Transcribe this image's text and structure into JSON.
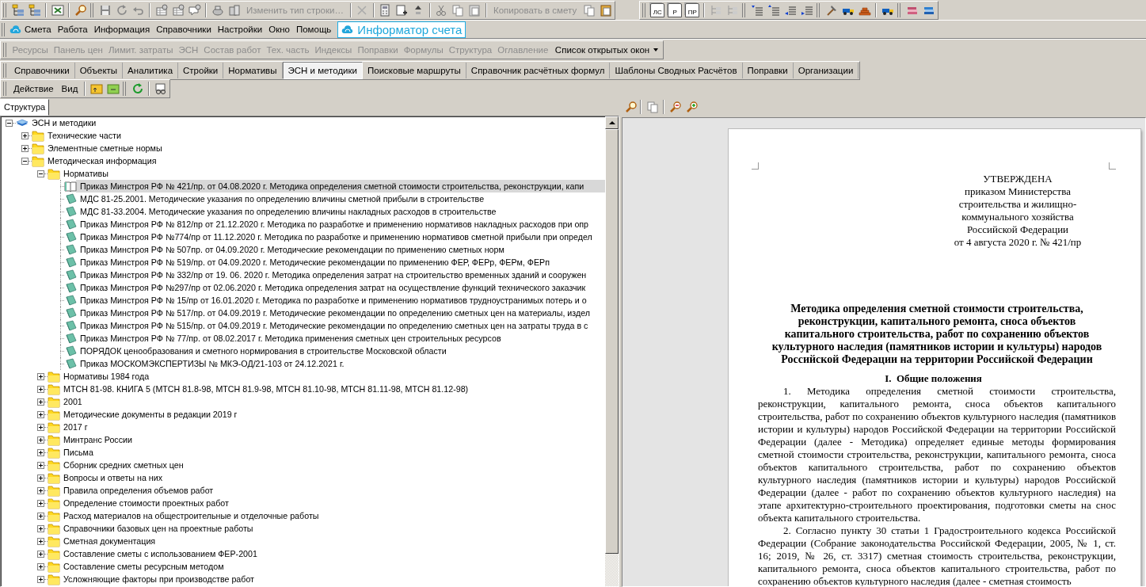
{
  "toolbar": {
    "buttons": [
      {
        "label": "Изменить тип строки…",
        "disabled": true
      },
      {
        "label": "Копировать в смету",
        "disabled": true
      }
    ],
    "badges": [
      "ЛС",
      "Р",
      "ПР"
    ]
  },
  "menu": {
    "items": [
      {
        "label": "Смета",
        "kind": "app"
      },
      {
        "label": "Работа",
        "kind": "plain"
      },
      {
        "label": "Информация",
        "kind": "plain"
      },
      {
        "label": "Справочники",
        "kind": "plain"
      },
      {
        "label": "Настройки",
        "kind": "plain"
      },
      {
        "label": "Окно",
        "kind": "plain"
      },
      {
        "label": "Помощь",
        "kind": "plain"
      }
    ],
    "informer": "Информатор счета"
  },
  "panel_bar": {
    "items": [
      {
        "label": "Ресурсы",
        "disabled": true
      },
      {
        "label": "Панель цен",
        "disabled": true
      },
      {
        "label": "Лимит. затраты",
        "disabled": true
      },
      {
        "label": "ЭСН",
        "disabled": true
      },
      {
        "label": "Состав работ",
        "disabled": true
      },
      {
        "label": "Тех. часть",
        "disabled": true
      },
      {
        "label": "Индексы",
        "disabled": true
      },
      {
        "label": "Поправки",
        "disabled": true
      },
      {
        "label": "Формулы",
        "disabled": true
      },
      {
        "label": "Структура",
        "disabled": true
      },
      {
        "label": "Оглавление",
        "disabled": true
      }
    ],
    "dropdown": "Список открытых окон"
  },
  "tabs": [
    {
      "label": "Справочники",
      "selected": false
    },
    {
      "label": "Объекты",
      "selected": false
    },
    {
      "label": "Аналитика",
      "selected": false
    },
    {
      "label": "Стройки",
      "selected": false
    },
    {
      "label": "Нормативы",
      "selected": false
    },
    {
      "label": "ЭСН и методики",
      "selected": true
    },
    {
      "label": "Поисковые маршруты",
      "selected": false
    },
    {
      "label": "Справочник расчётных формул",
      "selected": false
    },
    {
      "label": "Шаблоны Сводных Расчётов",
      "selected": false
    },
    {
      "label": "Поправки",
      "selected": false
    },
    {
      "label": "Организации",
      "selected": false
    }
  ],
  "actions": [
    "Действие",
    "Вид"
  ],
  "structure_tab": "Структура",
  "tree": {
    "label": "ЭСН и методики",
    "kind": "root",
    "expanded": true,
    "selected": false,
    "children": [
      {
        "label": "Технические части",
        "kind": "folder",
        "expanded": false,
        "selected": false
      },
      {
        "label": "Элементные сметные нормы",
        "kind": "folder",
        "expanded": false,
        "selected": false
      },
      {
        "label": "Методическая информация",
        "kind": "folder",
        "expanded": true,
        "selected": false,
        "children": [
          {
            "label": "Нормативы",
            "kind": "folder",
            "expanded": true,
            "selected": false,
            "children": [
              {
                "label": "Приказ Минстроя РФ № 421/пр. от 04.08.2020 г. Методика определения сметной стоимости строительства, реконструкции, капи",
                "kind": "open-book",
                "selected": true
              },
              {
                "label": "МДС 81-25.2001. Методические указания по определению вличины сметной прибыли в строительстве",
                "kind": "book",
                "selected": false
              },
              {
                "label": "МДС 81-33.2004. Методические указания по определению вличины накладных расходов в строительстве",
                "kind": "book",
                "selected": false
              },
              {
                "label": "Приказ Минстроя РФ № 812/пр от 21.12.2020 г. Методика по разработке и применению нормативов накладных расходов при опр",
                "kind": "book",
                "selected": false
              },
              {
                "label": "Приказ Минстроя РФ №774/пр от 11.12.2020 г. Методика по разработке и применению нормативов сметной прибыли при определ",
                "kind": "book",
                "selected": false
              },
              {
                "label": "Приказ Минстроя РФ № 507пр. от 04.09.2020 г. Методические рекомендации по применению сметных норм",
                "kind": "book",
                "selected": false
              },
              {
                "label": "Приказ Минстроя РФ № 519/пр. от 04.09.2020 г. Методические рекомендации по применению ФЕР, ФЕРр, ФЕРм, ФЕРп",
                "kind": "book",
                "selected": false
              },
              {
                "label": "Приказ Минстроя РФ № 332/пр от 19. 06. 2020 г. Методика определения затрат на строительство временных зданий и сооружен",
                "kind": "book",
                "selected": false
              },
              {
                "label": "Приказ Минстроя РФ №297/пр от 02.06.2020 г. Методика определения затрат на осуществление функций технического заказчик",
                "kind": "book",
                "selected": false
              },
              {
                "label": "Приказ Минстроя РФ № 15/пр от 16.01.2020 г. Методика по разработке и применению нормативов трудноустранимых потерь и о",
                "kind": "book",
                "selected": false
              },
              {
                "label": "Приказ Минстроя РФ № 517/пр. от 04.09.2019 г. Методические рекомендации по определению сметных цен на материалы, издел",
                "kind": "book",
                "selected": false
              },
              {
                "label": "Приказ Минстроя РФ № 515/пр. от 04.09.2019 г. Методические рекомендации по определению сметных цен на затраты труда в с",
                "kind": "book",
                "selected": false
              },
              {
                "label": "Приказ Минстроя РФ № 77/пр. от 08.02.2017 г. Методика применения сметных цен строительных ресурсов",
                "kind": "book",
                "selected": false
              },
              {
                "label": "ПОРЯДОК ценообразования и сметного нормирования в строительстве Московской области",
                "kind": "book",
                "selected": false
              },
              {
                "label": "Приказ МОСКОМЭКСПЕРТИЗЫ № МКЭ-ОД/21-103 от 24.12.2021 г.",
                "kind": "book",
                "selected": false
              }
            ]
          },
          {
            "label": "Нормативы 1984 года",
            "kind": "folder",
            "expanded": false,
            "selected": false
          },
          {
            "label": "МТСН 81-98. КНИГА 5 (МТСН 81.8-98, МТСН 81.9-98, МТСН 81.10-98, МТСН 81.11-98, МТСН 81.12-98)",
            "kind": "folder",
            "expanded": false,
            "selected": false
          },
          {
            "label": "2001",
            "kind": "folder",
            "expanded": false,
            "selected": false
          },
          {
            "label": "Методические документы в редакции 2019 г",
            "kind": "folder",
            "expanded": false,
            "selected": false
          },
          {
            "label": "2017 г",
            "kind": "folder",
            "expanded": false,
            "selected": false
          },
          {
            "label": "Минтранс России",
            "kind": "folder",
            "expanded": false,
            "selected": false
          },
          {
            "label": "Письма",
            "kind": "folder",
            "expanded": false,
            "selected": false
          },
          {
            "label": "Сборник средних сметных цен",
            "kind": "folder",
            "expanded": false,
            "selected": false
          },
          {
            "label": "Вопросы и ответы на них",
            "kind": "folder",
            "expanded": false,
            "selected": false
          },
          {
            "label": "Правила определения объемов работ",
            "kind": "folder",
            "expanded": false,
            "selected": false
          },
          {
            "label": "Определение стоимости проектных работ",
            "kind": "folder",
            "expanded": false,
            "selected": false
          },
          {
            "label": "Расход материалов на общестроительные и отделочные работы",
            "kind": "folder",
            "expanded": false,
            "selected": false
          },
          {
            "label": "Справочники базовых цен на проектные работы",
            "kind": "folder",
            "expanded": false,
            "selected": false
          },
          {
            "label": "Сметная документация",
            "kind": "folder",
            "expanded": false,
            "selected": false
          },
          {
            "label": "Составление сметы с использованием  ФЕР-2001",
            "kind": "folder",
            "expanded": false,
            "selected": false
          },
          {
            "label": "Составление сметы ресурсным методом",
            "kind": "folder",
            "expanded": false,
            "selected": false
          },
          {
            "label": "Усложняющие факторы при производстве работ",
            "kind": "folder",
            "expanded": false,
            "selected": false
          }
        ]
      }
    ]
  },
  "document": {
    "approval": [
      "УТВЕРЖДЕНА",
      "приказом Министерства",
      "строительства и жилищно-",
      "коммунального хозяйства",
      "Российской Федерации",
      "от 4 августа 2020 г. № 421/пр"
    ],
    "title": "Методика определения сметной стоимости строительства, реконструкции, капитального ремонта, сноса объектов капитального строительства, работ по сохранению объектов культурного наследия (памятников истории и культуры) народов Российской Федерации на территории Российской Федерации",
    "heading": "I.  Общие положения",
    "paragraphs": [
      "1. Методика определения сметной стоимости строительства, реконструкции, капитального ремонта, сноса объектов капитального строительства, работ по сохранению объектов культурного наследия (памятников истории и культуры) народов Российской Федерации на территории Российской Федерации (далее - Методика) определяет единые методы формирования сметной стоимости строительства, реконструкции, капитального ремонта, сноса объектов капитального строительства, работ по сохранению объектов культурного наследия (памятников истории и культуры) народов Российской Федерации (далее - работ по сохранению объектов культурного наследия) на этапе архитектурно-строительного проектирования, подготовки сметы на снос объекта капитального строительства.",
      "2. Согласно пункту 30 статьи 1 Градостроительного кодекса Российской Федерации (Собрание законодательства Российской Федерации, 2005, № 1, ст. 16; 2019, № 26, ст. 3317) сметная стоимость строительства, реконструкции, капитального ремонта, сноса объектов капитального строительства, работ по сохранению объектов культурного наследия (далее - сметная стоимость"
    ]
  }
}
